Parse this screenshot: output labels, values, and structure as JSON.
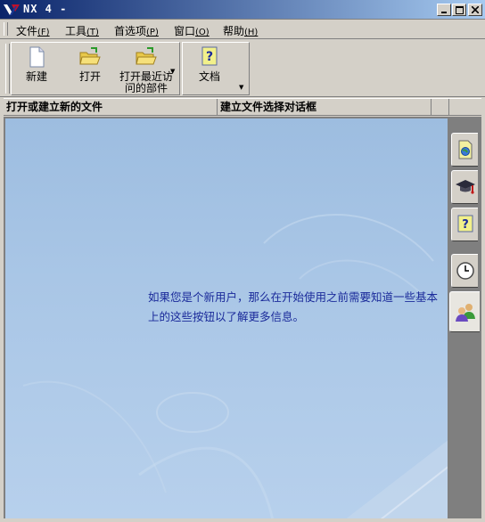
{
  "window": {
    "title": "NX 4 -"
  },
  "menu": {
    "items": [
      {
        "label": "文件",
        "accel": "(F)"
      },
      {
        "label": "工具",
        "accel": "(T)"
      },
      {
        "label": "首选项",
        "accel": "(P)"
      },
      {
        "label": "窗口",
        "accel": "(O)"
      },
      {
        "label": "帮助",
        "accel": "(H)"
      }
    ]
  },
  "toolbar": {
    "new_label": "新建",
    "open_label": "打开",
    "recent_label_line1": "打开最近访",
    "recent_label_line2": "问的部件",
    "docs_label": "文档"
  },
  "status": {
    "left": "打开或建立新的文件",
    "right": "建立文件选择对话框"
  },
  "welcome": {
    "line1": "如果您是个新用户，那么在开始使用之前需要知道一些基本",
    "line2": "上的这些按钮以了解更多信息。"
  },
  "icons": {
    "sidebar": [
      "web-page-icon",
      "graduation-cap-icon",
      "help-icon",
      "clock-icon",
      "users-icon"
    ]
  },
  "colors": {
    "titlebar_start": "#0a246a",
    "titlebar_end": "#a6caf0",
    "welcome_text": "#1a2a9a"
  }
}
